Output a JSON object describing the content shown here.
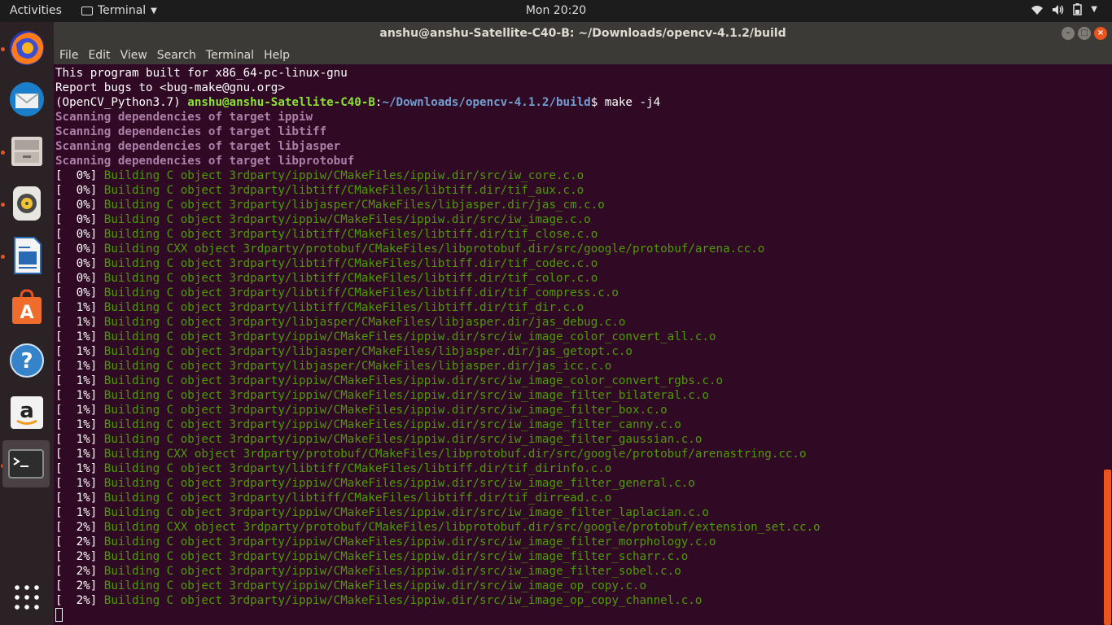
{
  "topbar": {
    "activities": "Activities",
    "app_name": "Terminal",
    "clock": "Mon 20:20"
  },
  "dock": {
    "items": [
      {
        "name": "firefox-icon",
        "running": true
      },
      {
        "name": "thunderbird-icon",
        "running": false
      },
      {
        "name": "files-icon",
        "running": true
      },
      {
        "name": "rhythmbox-icon",
        "running": true
      },
      {
        "name": "libreoffice-writer-icon",
        "running": true
      },
      {
        "name": "ubuntu-software-icon",
        "running": false
      },
      {
        "name": "help-icon",
        "running": false
      },
      {
        "name": "amazon-icon",
        "running": false
      },
      {
        "name": "terminal-icon",
        "running": true,
        "active": true
      }
    ],
    "show_apps_icon": "grid-icon"
  },
  "window": {
    "title": "anshu@anshu-Satellite-C40-B: ~/Downloads/opencv-4.1.2/build"
  },
  "menubar": {
    "items": [
      "File",
      "Edit",
      "View",
      "Search",
      "Terminal",
      "Help"
    ]
  },
  "colors": {
    "terminal_bg": "#300a24",
    "green": "#4e9a06",
    "magenta": "#ad7fa8",
    "user": "#8ae234",
    "path": "#729fcf",
    "accent": "#e95420"
  },
  "terminal": {
    "lines": [
      {
        "type": "plain",
        "text": "This program built for x86_64-pc-linux-gnu"
      },
      {
        "type": "plain",
        "text": "Report bugs to <bug-make@gnu.org>"
      },
      {
        "type": "prompt",
        "env": "(OpenCV_Python3.7) ",
        "user": "anshu@anshu-Satellite-C40-B",
        "sep": ":",
        "path": "~/Downloads/opencv-4.1.2/build",
        "cmd": "$ make -j4"
      },
      {
        "type": "scan",
        "text": "Scanning dependencies of target ippiw"
      },
      {
        "type": "scan",
        "text": "Scanning dependencies of target libtiff"
      },
      {
        "type": "scan",
        "text": "Scanning dependencies of target libjasper"
      },
      {
        "type": "scan",
        "text": "Scanning dependencies of target libprotobuf"
      },
      {
        "type": "build",
        "pct": "[  0%] ",
        "text": "Building C object 3rdparty/ippiw/CMakeFiles/ippiw.dir/src/iw_core.c.o"
      },
      {
        "type": "build",
        "pct": "[  0%] ",
        "text": "Building C object 3rdparty/libtiff/CMakeFiles/libtiff.dir/tif_aux.c.o"
      },
      {
        "type": "build",
        "pct": "[  0%] ",
        "text": "Building C object 3rdparty/libjasper/CMakeFiles/libjasper.dir/jas_cm.c.o"
      },
      {
        "type": "build",
        "pct": "[  0%] ",
        "text": "Building C object 3rdparty/ippiw/CMakeFiles/ippiw.dir/src/iw_image.c.o"
      },
      {
        "type": "build",
        "pct": "[  0%] ",
        "text": "Building C object 3rdparty/libtiff/CMakeFiles/libtiff.dir/tif_close.c.o"
      },
      {
        "type": "build",
        "pct": "[  0%] ",
        "text": "Building CXX object 3rdparty/protobuf/CMakeFiles/libprotobuf.dir/src/google/protobuf/arena.cc.o"
      },
      {
        "type": "build",
        "pct": "[  0%] ",
        "text": "Building C object 3rdparty/libtiff/CMakeFiles/libtiff.dir/tif_codec.c.o"
      },
      {
        "type": "build",
        "pct": "[  0%] ",
        "text": "Building C object 3rdparty/libtiff/CMakeFiles/libtiff.dir/tif_color.c.o"
      },
      {
        "type": "build",
        "pct": "[  0%] ",
        "text": "Building C object 3rdparty/libtiff/CMakeFiles/libtiff.dir/tif_compress.c.o"
      },
      {
        "type": "build",
        "pct": "[  1%] ",
        "text": "Building C object 3rdparty/libtiff/CMakeFiles/libtiff.dir/tif_dir.c.o"
      },
      {
        "type": "build",
        "pct": "[  1%] ",
        "text": "Building C object 3rdparty/libjasper/CMakeFiles/libjasper.dir/jas_debug.c.o"
      },
      {
        "type": "build",
        "pct": "[  1%] ",
        "text": "Building C object 3rdparty/ippiw/CMakeFiles/ippiw.dir/src/iw_image_color_convert_all.c.o"
      },
      {
        "type": "build",
        "pct": "[  1%] ",
        "text": "Building C object 3rdparty/libjasper/CMakeFiles/libjasper.dir/jas_getopt.c.o"
      },
      {
        "type": "build",
        "pct": "[  1%] ",
        "text": "Building C object 3rdparty/libjasper/CMakeFiles/libjasper.dir/jas_icc.c.o"
      },
      {
        "type": "build",
        "pct": "[  1%] ",
        "text": "Building C object 3rdparty/ippiw/CMakeFiles/ippiw.dir/src/iw_image_color_convert_rgbs.c.o"
      },
      {
        "type": "build",
        "pct": "[  1%] ",
        "text": "Building C object 3rdparty/ippiw/CMakeFiles/ippiw.dir/src/iw_image_filter_bilateral.c.o"
      },
      {
        "type": "build",
        "pct": "[  1%] ",
        "text": "Building C object 3rdparty/ippiw/CMakeFiles/ippiw.dir/src/iw_image_filter_box.c.o"
      },
      {
        "type": "build",
        "pct": "[  1%] ",
        "text": "Building C object 3rdparty/ippiw/CMakeFiles/ippiw.dir/src/iw_image_filter_canny.c.o"
      },
      {
        "type": "build",
        "pct": "[  1%] ",
        "text": "Building C object 3rdparty/ippiw/CMakeFiles/ippiw.dir/src/iw_image_filter_gaussian.c.o"
      },
      {
        "type": "build",
        "pct": "[  1%] ",
        "text": "Building CXX object 3rdparty/protobuf/CMakeFiles/libprotobuf.dir/src/google/protobuf/arenastring.cc.o"
      },
      {
        "type": "build",
        "pct": "[  1%] ",
        "text": "Building C object 3rdparty/libtiff/CMakeFiles/libtiff.dir/tif_dirinfo.c.o"
      },
      {
        "type": "build",
        "pct": "[  1%] ",
        "text": "Building C object 3rdparty/ippiw/CMakeFiles/ippiw.dir/src/iw_image_filter_general.c.o"
      },
      {
        "type": "build",
        "pct": "[  1%] ",
        "text": "Building C object 3rdparty/libtiff/CMakeFiles/libtiff.dir/tif_dirread.c.o"
      },
      {
        "type": "build",
        "pct": "[  1%] ",
        "text": "Building C object 3rdparty/ippiw/CMakeFiles/ippiw.dir/src/iw_image_filter_laplacian.c.o"
      },
      {
        "type": "build",
        "pct": "[  2%] ",
        "text": "Building CXX object 3rdparty/protobuf/CMakeFiles/libprotobuf.dir/src/google/protobuf/extension_set.cc.o"
      },
      {
        "type": "build",
        "pct": "[  2%] ",
        "text": "Building C object 3rdparty/ippiw/CMakeFiles/ippiw.dir/src/iw_image_filter_morphology.c.o"
      },
      {
        "type": "build",
        "pct": "[  2%] ",
        "text": "Building C object 3rdparty/ippiw/CMakeFiles/ippiw.dir/src/iw_image_filter_scharr.c.o"
      },
      {
        "type": "build",
        "pct": "[  2%] ",
        "text": "Building C object 3rdparty/ippiw/CMakeFiles/ippiw.dir/src/iw_image_filter_sobel.c.o"
      },
      {
        "type": "build",
        "pct": "[  2%] ",
        "text": "Building C object 3rdparty/ippiw/CMakeFiles/ippiw.dir/src/iw_image_op_copy.c.o"
      },
      {
        "type": "build",
        "pct": "[  2%] ",
        "text": "Building C object 3rdparty/ippiw/CMakeFiles/ippiw.dir/src/iw_image_op_copy_channel.c.o"
      }
    ]
  }
}
